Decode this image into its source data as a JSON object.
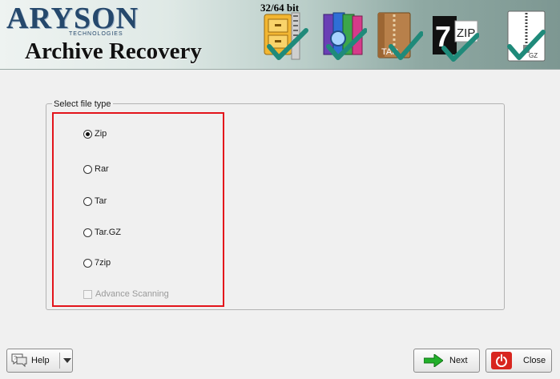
{
  "header": {
    "brand": "ARYSON",
    "brand_sub": "TECHNOLOGIES",
    "product": "Archive Recovery",
    "bit_label": "32/64 bit",
    "format_icons": [
      "zip-archive-icon",
      "rar-archive-icon",
      "tar-archive-icon",
      "7zip-archive-icon",
      "gz-archive-icon"
    ],
    "tar_label": "TAR",
    "sevenzip_label": "ZIP",
    "gz_label": "GZ"
  },
  "file_type": {
    "group_label": "Select file type",
    "selected": "Zip",
    "options": [
      "Zip",
      "Rar",
      "Tar",
      "Tar.GZ",
      "7zip"
    ],
    "advance_scanning_label": "Advance Scanning",
    "advance_scanning_checked": false,
    "advance_scanning_enabled": false
  },
  "footer": {
    "help_label": "Help",
    "next_label": "Next",
    "close_label": "Close"
  },
  "colors": {
    "highlight": "#e3141b",
    "brand": "#25486c",
    "check": "#1f8a7a"
  }
}
